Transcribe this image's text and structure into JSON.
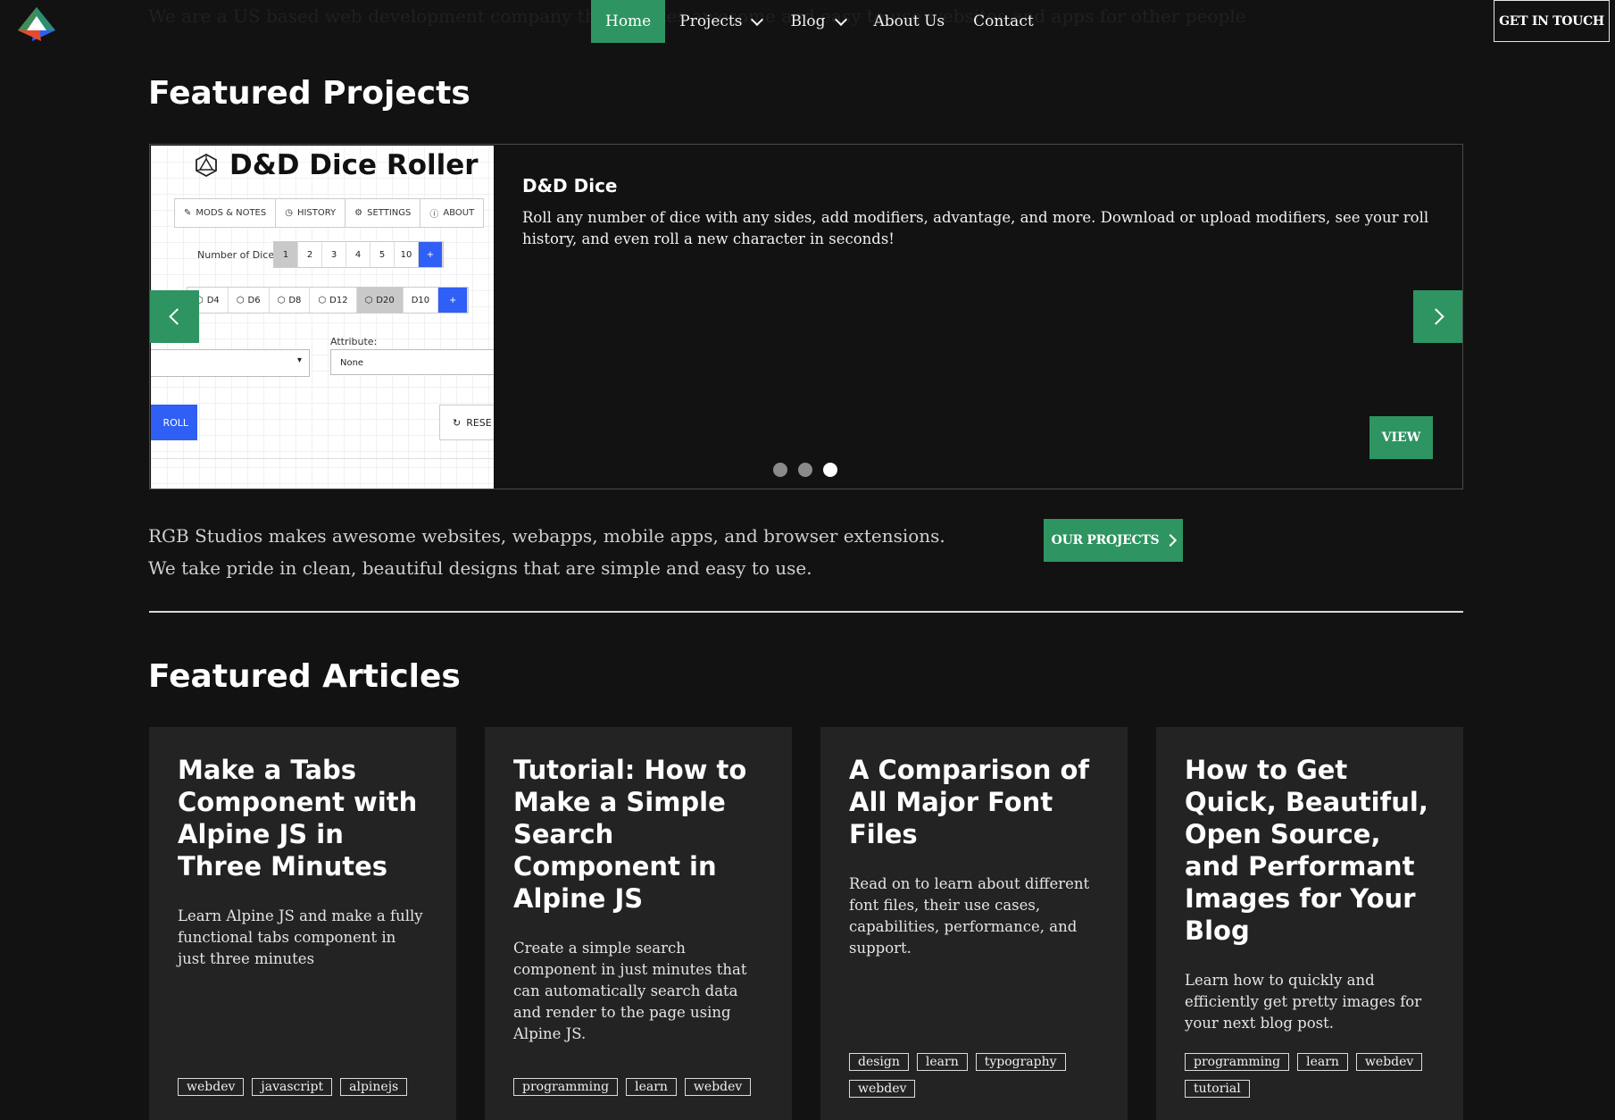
{
  "header": {
    "ghost_text": "We are a US based web development company that creates awesome and easy to use websites and apps for other people",
    "nav": [
      {
        "label": "Home",
        "active": true,
        "dropdown": false
      },
      {
        "label": "Projects",
        "active": false,
        "dropdown": true
      },
      {
        "label": "Blog",
        "active": false,
        "dropdown": true
      },
      {
        "label": "About Us",
        "active": false,
        "dropdown": false
      },
      {
        "label": "Contact",
        "active": false,
        "dropdown": false
      }
    ],
    "cta_label": "GET IN TOUCH"
  },
  "projects": {
    "title": "Featured Projects",
    "slide": {
      "title": "D&D Dice",
      "description": "Roll any number of dice with any sides, add modifiers, advantage, and more. Download or upload modifiers, see your roll history, and even roll a new character in seconds!",
      "view_label": "VIEW",
      "screenshot": {
        "app_title": "D&D Dice Roller",
        "tabs": [
          "MODS & NOTES",
          "HISTORY",
          "SETTINGS",
          "ABOUT"
        ],
        "number_label": "Number of Dice:",
        "numbers": [
          "1",
          "2",
          "3",
          "4",
          "5",
          "10",
          "+"
        ],
        "dice": [
          "D4",
          "D6",
          "D8",
          "D12",
          "D20",
          "D10",
          "+"
        ],
        "attribute_label": "Attribute:",
        "attribute_value": "None",
        "roll_label": "ROLL",
        "reset_label": "RESE"
      }
    },
    "slide_count": 3,
    "active_slide": 3,
    "intro": "RGB Studios makes awesome websites, webapps, mobile apps, and browser extensions. We take pride in clean, beautiful designs that are simple and easy to use.",
    "button_label": "OUR PROJECTS"
  },
  "articles": {
    "title": "Featured Articles",
    "items": [
      {
        "title": "Make a Tabs Component with Alpine JS in Three Minutes",
        "description": "Learn Alpine JS and make a fully functional tabs component in just three minutes",
        "tags": [
          "webdev",
          "javascript",
          "alpinejs"
        ]
      },
      {
        "title": "Tutorial: How to Make a Simple Search Component in Alpine JS",
        "description": "Create a simple search component in just minutes that can automatically search data and render to the page using Alpine JS.",
        "tags": [
          "programming",
          "learn",
          "webdev"
        ]
      },
      {
        "title": "A Comparison of All Major Font Files",
        "description": "Read on to learn about different font files, their use cases, capabilities, performance, and support.",
        "tags": [
          "design",
          "learn",
          "typography",
          "webdev"
        ]
      },
      {
        "title": "How to Get Quick, Beautiful, Open Source, and Performant Images for Your Blog",
        "description": "Learn how to quickly and efficiently get pretty images for your next blog post.",
        "tags": [
          "programming",
          "learn",
          "webdev",
          "tutorial"
        ]
      }
    ]
  },
  "colors": {
    "accent": "#2e9461",
    "background": "#121212",
    "card": "#232323",
    "screenshot_blue": "#2f5ff5"
  }
}
